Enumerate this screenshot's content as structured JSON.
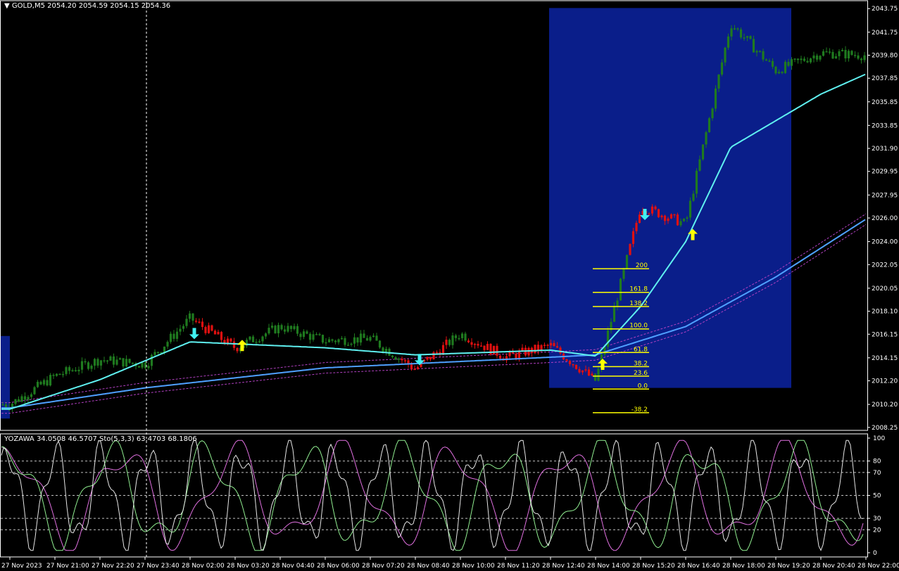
{
  "chart_data": [
    {
      "type": "candlestick",
      "title": "GOLD,M5",
      "ohlc_readout": [
        "2054.20",
        "2054.59",
        "2054.15",
        "2054.36"
      ],
      "y_ticks": [
        "2043.75",
        "2041.75",
        "2039.80",
        "2037.85",
        "2035.85",
        "2033.85",
        "2031.90",
        "2029.95",
        "2027.95",
        "2026.00",
        "2024.00",
        "2022.05",
        "2020.05",
        "2018.10",
        "2016.15",
        "2014.15",
        "2012.20",
        "2010.20",
        "2008.25"
      ],
      "ylim": [
        2008.0,
        2044.3
      ],
      "x_ticks": [
        "27 Nov 2023",
        "27 Nov 21:00",
        "27 Nov 22:20",
        "27 Nov 23:40",
        "28 Nov 02:00",
        "28 Nov 03:20",
        "28 Nov 04:40",
        "28 Nov 06:00",
        "28 Nov 07:20",
        "28 Nov 08:40",
        "28 Nov 10:00",
        "28 Nov 11:20",
        "28 Nov 12:40",
        "28 Nov 14:00",
        "28 Nov 15:20",
        "28 Nov 16:40",
        "28 Nov 18:00",
        "28 Nov 19:20",
        "28 Nov 20:40",
        "28 Nov 22:00"
      ],
      "colors": {
        "up": "#1f7a1f",
        "down": "#e01010",
        "fast_ma": "#5ff0f0",
        "slow_ma": "#4fa0ff",
        "envelope": "#b040c0",
        "highlight": "#0a1e8a",
        "fib": "#ffff00",
        "arrow_up": "#ffff00",
        "arrow_down": "#40f0f0"
      },
      "fib_levels": [
        {
          "label": "200",
          "price": 2021.7
        },
        {
          "label": "161.8",
          "price": 2019.7
        },
        {
          "label": "138.2",
          "price": 2018.5
        },
        {
          "label": "100.0",
          "price": 2016.6
        },
        {
          "label": "61.8",
          "price": 2014.6
        },
        {
          "label": "38.2",
          "price": 2013.4
        },
        {
          "label": "23.6",
          "price": 2012.6
        },
        {
          "label": "0.0",
          "price": 2011.5
        },
        {
          "label": "-38.2",
          "price": 2009.5
        }
      ],
      "highlight_range": {
        "x_from": "28 Nov 12:40",
        "x_to": "28 Nov 19:20",
        "price_from": 2011.6,
        "price_to": 2043.8
      },
      "arrows": [
        {
          "dir": "down",
          "x": "28 Nov 02:00",
          "price": 2016.2
        },
        {
          "dir": "up",
          "x": "28 Nov 03:20",
          "price": 2015.2
        },
        {
          "dir": "down",
          "x": "28 Nov 08:40",
          "price": 2014.0
        },
        {
          "dir": "up",
          "x": "28 Nov 14:00",
          "price": 2013.6
        },
        {
          "dir": "down",
          "x": "28 Nov 15:20",
          "price": 2026.3
        },
        {
          "dir": "up",
          "x": "28 Nov 16:40",
          "price": 2024.6
        }
      ],
      "price_path": [
        [
          "27 Nov 2023",
          2010.2
        ],
        [
          "27 Nov 21:00",
          2012.6
        ],
        [
          "27 Nov 22:20",
          2014.0
        ],
        [
          "27 Nov 23:40",
          2013.6
        ],
        [
          "28 Nov 02:00",
          2017.5
        ],
        [
          "28 Nov 03:20",
          2015.0
        ],
        [
          "28 Nov 04:40",
          2016.8
        ],
        [
          "28 Nov 06:00",
          2015.6
        ],
        [
          "28 Nov 07:20",
          2015.8
        ],
        [
          "28 Nov 08:40",
          2013.2
        ],
        [
          "28 Nov 10:00",
          2016.2
        ],
        [
          "28 Nov 11:20",
          2014.2
        ],
        [
          "28 Nov 12:40",
          2015.2
        ],
        [
          "28 Nov 14:00",
          2012.2
        ],
        [
          "28 Nov 15:20",
          2027.0
        ],
        [
          "28 Nov 16:40",
          2025.5
        ],
        [
          "28 Nov 18:00",
          2042.5
        ],
        [
          "28 Nov 19:20",
          2038.5
        ],
        [
          "28 Nov 20:40",
          2040.0
        ],
        [
          "28 Nov 22:00",
          2039.8
        ]
      ],
      "fast_ma_path": [
        [
          "27 Nov 2023",
          2009.8
        ],
        [
          "27 Nov 22:20",
          2012.3
        ],
        [
          "28 Nov 02:00",
          2015.5
        ],
        [
          "28 Nov 06:00",
          2015.0
        ],
        [
          "28 Nov 08:40",
          2014.4
        ],
        [
          "28 Nov 12:40",
          2014.8
        ],
        [
          "28 Nov 14:00",
          2014.3
        ],
        [
          "28 Nov 15:20",
          2018.5
        ],
        [
          "28 Nov 16:40",
          2024.0
        ],
        [
          "28 Nov 18:00",
          2032.0
        ],
        [
          "28 Nov 20:40",
          2036.5
        ],
        [
          "28 Nov 22:00",
          2038.2
        ]
      ],
      "slow_ma_path": [
        [
          "27 Nov 2023",
          2009.9
        ],
        [
          "27 Nov 23:40",
          2011.6
        ],
        [
          "28 Nov 06:00",
          2013.3
        ],
        [
          "28 Nov 12:40",
          2014.2
        ],
        [
          "28 Nov 14:00",
          2014.4
        ],
        [
          "28 Nov 16:40",
          2016.8
        ],
        [
          "28 Nov 19:20",
          2021.0
        ],
        [
          "28 Nov 22:00",
          2025.9
        ]
      ]
    },
    {
      "type": "line",
      "title": "YOZAWA 34.0508 46.5707",
      "stoch_title": "Sto(5,3,3) 63.4703 68.1806",
      "ylim": [
        0,
        100
      ],
      "y_ticks": [
        "100",
        "80",
        "70",
        "50",
        "30",
        "20",
        "0"
      ],
      "levels": [
        80,
        70,
        50,
        30,
        20
      ],
      "series_colors": {
        "stoch_raw": "#e6e6e6",
        "stoch_main": "#90ee90",
        "stoch_signal": "#e070e0"
      }
    }
  ]
}
